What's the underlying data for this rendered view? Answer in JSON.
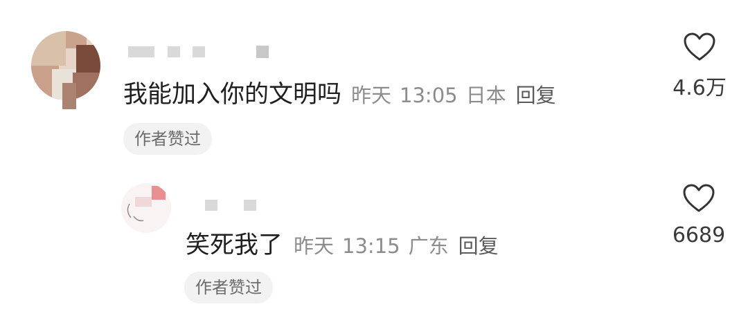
{
  "comments": [
    {
      "text": "我能加入你的文明吗",
      "date": "昨天",
      "time": "13:05",
      "location": "日本",
      "reply_label": "回复",
      "badge": "作者赞过",
      "like_count": "4.6万"
    },
    {
      "text": "笑死我了",
      "date": "昨天",
      "time": "13:15",
      "location": "广东",
      "reply_label": "回复",
      "badge": "作者赞过",
      "like_count": "6689"
    }
  ],
  "colors": {
    "text": "#1f1f1f",
    "meta": "#8c8c8c",
    "badge_bg": "#f2f2f2",
    "heart_stroke": "#333333"
  },
  "icons": {
    "like": "heart-outline-icon"
  }
}
